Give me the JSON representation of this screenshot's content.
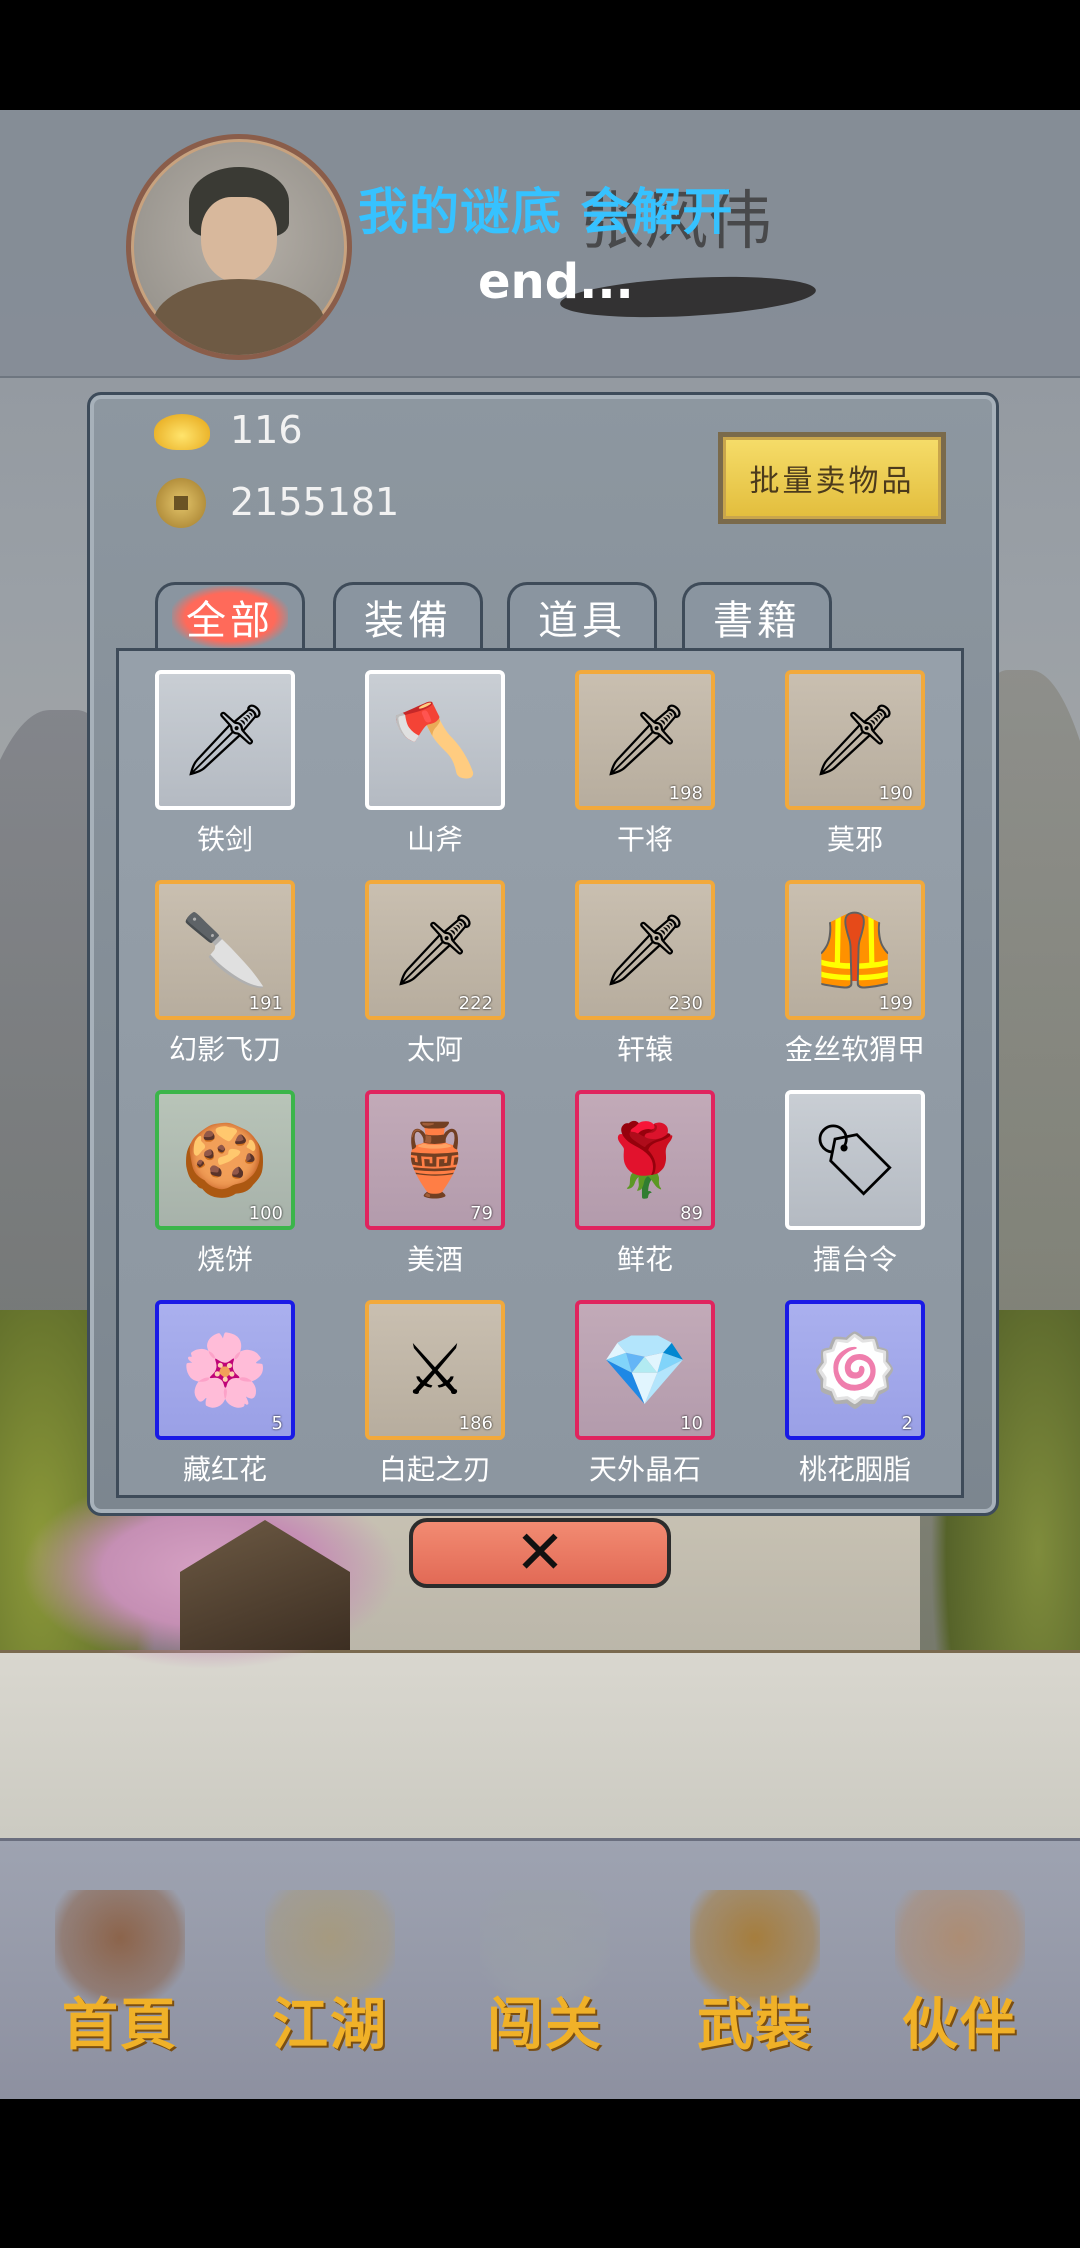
{
  "player": {
    "name": "张风伟"
  },
  "overlay": {
    "title": "我的谜底 会解开",
    "subtitle": "end..."
  },
  "currency": {
    "ingot": "116",
    "coins": "2155181"
  },
  "buttons": {
    "sell_all": "批量卖物品",
    "close": "✕"
  },
  "tabs": [
    {
      "label": "全部",
      "active": true
    },
    {
      "label": "装備",
      "active": false
    },
    {
      "label": "道具",
      "active": false
    },
    {
      "label": "書籍",
      "active": false
    }
  ],
  "items": [
    {
      "name": "铁剑",
      "count": "",
      "border": "#ffffff",
      "icon": "sword-icon"
    },
    {
      "name": "山斧",
      "count": "",
      "border": "#ffffff",
      "icon": "axe-icon"
    },
    {
      "name": "干将",
      "count": "198",
      "border": "#f2a93b",
      "icon": "sword-icon"
    },
    {
      "name": "莫邪",
      "count": "190",
      "border": "#f2a93b",
      "icon": "sword-icon"
    },
    {
      "name": "幻影飞刀",
      "count": "191",
      "border": "#f2a93b",
      "icon": "knife-icon"
    },
    {
      "name": "太阿",
      "count": "222",
      "border": "#f2a93b",
      "icon": "sword-icon"
    },
    {
      "name": "轩辕",
      "count": "230",
      "border": "#f2a93b",
      "icon": "sword-icon"
    },
    {
      "name": "金丝软猬甲",
      "count": "199",
      "border": "#f2a93b",
      "icon": "armor-icon"
    },
    {
      "name": "烧饼",
      "count": "100",
      "border": "#3bb54a",
      "icon": "bread-icon"
    },
    {
      "name": "美酒",
      "count": "79",
      "border": "#e0245e",
      "icon": "wine-jar-icon"
    },
    {
      "name": "鲜花",
      "count": "89",
      "border": "#e0245e",
      "icon": "rose-icon"
    },
    {
      "name": "擂台令",
      "count": "",
      "border": "#ffffff",
      "icon": "token-icon"
    },
    {
      "name": "藏红花",
      "count": "5",
      "border": "#1a1ae6",
      "icon": "flower-icon"
    },
    {
      "name": "白起之刃",
      "count": "186",
      "border": "#f2a93b",
      "icon": "blade-icon"
    },
    {
      "name": "天外晶石",
      "count": "10",
      "border": "#e0245e",
      "icon": "crystal-icon"
    },
    {
      "name": "桃花胭脂",
      "count": "2",
      "border": "#1a1ae6",
      "icon": "rouge-icon"
    }
  ],
  "nav": [
    {
      "label": "首頁",
      "icon": "home-icon",
      "color": "#8a5a3a"
    },
    {
      "label": "江湖",
      "icon": "scroll-icon",
      "color": "#a89a78"
    },
    {
      "label": "闯关",
      "icon": "crossed-swords-icon",
      "color": "#9aa0a8"
    },
    {
      "label": "武裝",
      "icon": "armor-icon",
      "color": "#a8782a"
    },
    {
      "label": "伙伴",
      "icon": "partners-icon",
      "color": "#b08a6a"
    }
  ]
}
